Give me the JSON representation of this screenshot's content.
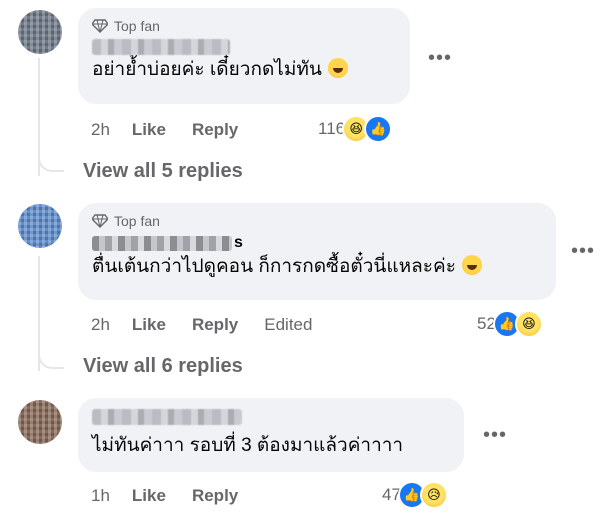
{
  "comments": [
    {
      "badge": "Top fan",
      "text": "อย่าย้ำบ่อยค่ะ เดี๋ยวกดไม่ทัน",
      "time": "2h",
      "like": "Like",
      "reply": "Reply",
      "edited": "",
      "reaction_count": "116",
      "reactions": [
        "haha",
        "like"
      ],
      "view_replies": "View all 5 replies"
    },
    {
      "badge": "Top fan",
      "name_visible": "s",
      "text": "ตื่นเต้นกว่าไปดูคอน ก็การกดซื้อตั๋วนี่แหละค่ะ",
      "time": "2h",
      "like": "Like",
      "reply": "Reply",
      "edited": "Edited",
      "reaction_count": "52",
      "reactions": [
        "like",
        "haha"
      ],
      "view_replies": "View all 6 replies"
    },
    {
      "badge": "",
      "text": "ไม่ทันค่าาา รอบที่ 3 ต้องมาแล้วค่าาาา",
      "time": "1h",
      "like": "Like",
      "reply": "Reply",
      "edited": "",
      "reaction_count": "47",
      "reactions": [
        "like",
        "sad"
      ],
      "view_replies": ""
    }
  ],
  "icons": {
    "badge": "diamond-icon",
    "more": "more-options-icon",
    "like_reaction": "thumbs-up-icon",
    "haha_reaction": "laughing-face-icon",
    "sad_reaction": "sad-face-icon"
  },
  "colors": {
    "bubble_bg": "#f0f2f5",
    "meta_text": "#65676b",
    "like_blue": "#1877f2"
  }
}
